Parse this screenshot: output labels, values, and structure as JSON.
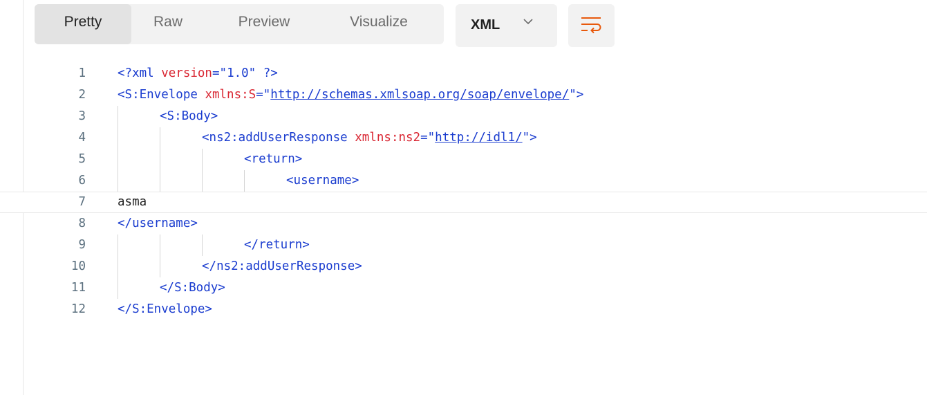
{
  "toolbar": {
    "tabs": [
      "Pretty",
      "Raw",
      "Preview",
      "Visualize"
    ],
    "active_tab": "Pretty",
    "language": "XML",
    "wrap_icon": "wrap-lines-icon",
    "chevron_icon": "chevron-down-icon"
  },
  "colors": {
    "tag": "#1a3ccf",
    "attribute": "#d92632",
    "text": "#212121",
    "line_number": "#5a6f7e",
    "wrap_icon": "#e8590c"
  },
  "code": {
    "line_numbers": [
      "1",
      "2",
      "3",
      "4",
      "5",
      "6",
      "7",
      "8",
      "9",
      "10",
      "11",
      "12"
    ],
    "l1": {
      "open": "<?xml ",
      "attr": "version",
      "eq": "=",
      "val": "\"1.0\"",
      "close": " ?>"
    },
    "l2": {
      "open": "<S:Envelope ",
      "attr": "xmlns:S",
      "eq": "=\"",
      "link": "http://schemas.xmlsoap.org/soap/envelope/",
      "close": "\">"
    },
    "l3": "<S:Body>",
    "l4": {
      "open": "<ns2:addUserResponse ",
      "attr": "xmlns:ns2",
      "eq": "=\"",
      "link": "http://idl1/",
      "close": "\">"
    },
    "l5": "<return>",
    "l6": "<username>",
    "l7": "asma",
    "l8": "</username>",
    "l9": "</return>",
    "l10": "</ns2:addUserResponse>",
    "l11": "</S:Body>",
    "l12": "</S:Envelope>"
  }
}
